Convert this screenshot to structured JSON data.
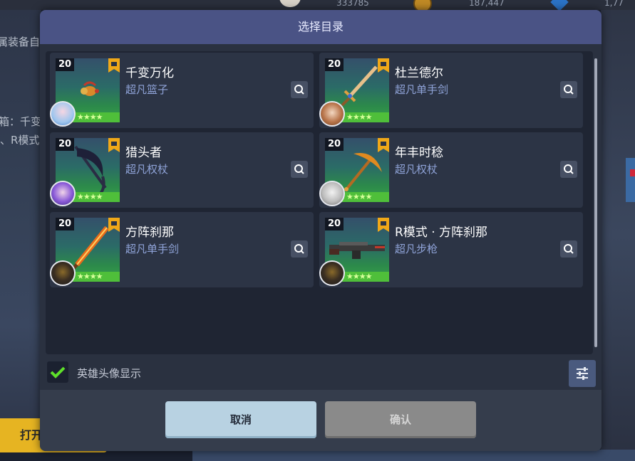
{
  "background": {
    "currency_1": "333785",
    "currency_2": "187,447",
    "currency_3": "1,77",
    "left_text_1": "属装备自",
    "left_text_2": "箱：千变",
    "left_text_3": "、R模式",
    "open_button": "打开"
  },
  "dialog": {
    "title": "选择目录",
    "items": [
      {
        "level": "20",
        "name": "千变万化",
        "type": "超凡篮子",
        "stars": "★★★★",
        "weapon": "basket-icon"
      },
      {
        "level": "20",
        "name": "杜兰德尔",
        "type": "超凡单手剑",
        "stars": "★★★★",
        "weapon": "sword-icon"
      },
      {
        "level": "20",
        "name": "猎头者",
        "type": "超凡权杖",
        "stars": "★★★★",
        "weapon": "scythe-icon"
      },
      {
        "level": "20",
        "name": "年丰时稔",
        "type": "超凡权杖",
        "stars": "★★★★",
        "weapon": "pickaxe-icon"
      },
      {
        "level": "20",
        "name": "方阵刹那",
        "type": "超凡单手剑",
        "stars": "★★★★",
        "weapon": "flame-sword-icon"
      },
      {
        "level": "20",
        "name": "R模式 · 方阵刹那",
        "type": "超凡步枪",
        "stars": "★★★★",
        "weapon": "rifle-icon"
      }
    ],
    "show_hero_avatar_label": "英雄头像显示",
    "show_hero_avatar_checked": true,
    "cancel_label": "取消",
    "confirm_label": "确认"
  },
  "colors": {
    "header": "#4a5385",
    "type_text": "#8fa3d8",
    "check": "#5ee02a",
    "cancel_button": "#b8d2e2",
    "confirm_button": "#8a8a8a"
  }
}
